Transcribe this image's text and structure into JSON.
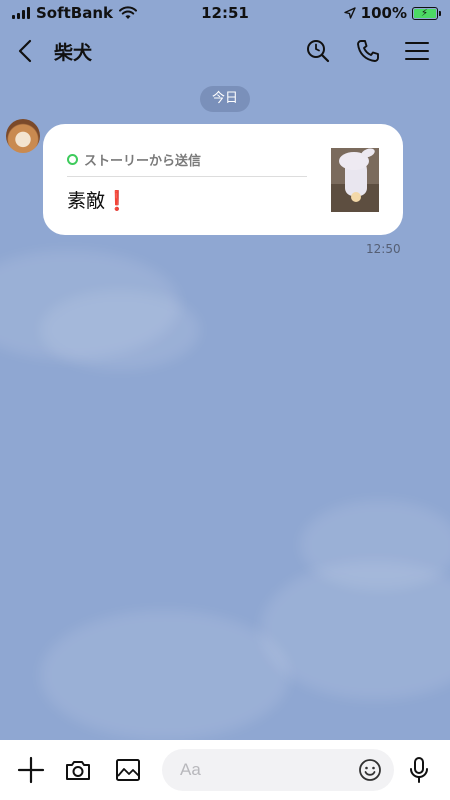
{
  "status_bar": {
    "carrier": "SoftBank",
    "time": "12:51",
    "battery": "100%"
  },
  "header": {
    "title": "柴犬",
    "icons": [
      "chevron-left-icon",
      "search-icon",
      "phone-icon",
      "menu-icon"
    ]
  },
  "chat": {
    "date_label": "今日",
    "messages": [
      {
        "story_label": "ストーリーから送信",
        "text": "素敵",
        "emoji": "❗",
        "time": "12:50"
      }
    ]
  },
  "input_bar": {
    "placeholder": "Aa",
    "icons": [
      "plus-icon",
      "camera-icon",
      "image-icon",
      "emoji-icon",
      "mic-icon"
    ]
  },
  "colors": {
    "background": "#8fa7d2",
    "story_ring": "#3ecb5c",
    "exclamation": "#d1232a"
  }
}
